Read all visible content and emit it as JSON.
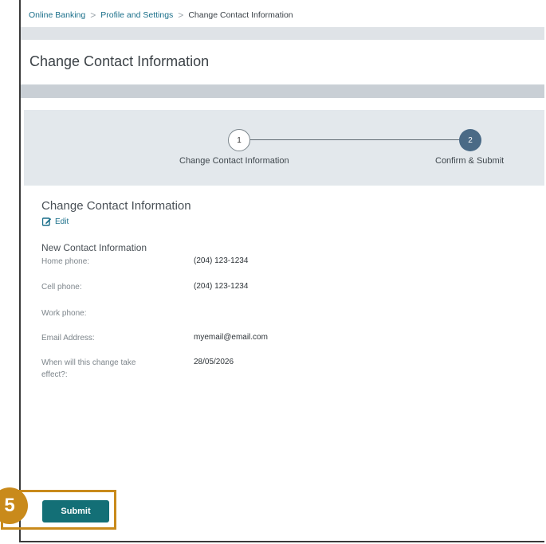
{
  "breadcrumb": {
    "items": [
      "Online Banking",
      "Profile and Settings",
      "Change Contact Information"
    ],
    "separator": ">"
  },
  "page": {
    "title": "Change Contact Information"
  },
  "stepper": {
    "steps": [
      {
        "number": "1",
        "label": "Change Contact Information"
      },
      {
        "number": "2",
        "label": "Confirm & Submit"
      }
    ],
    "active_step": 2
  },
  "summary": {
    "title": "Change Contact Information",
    "edit_label": "Edit",
    "subtitle": "New Contact Information",
    "fields": [
      {
        "label": "Home phone:",
        "value": "(204) 123-1234"
      },
      {
        "label": "Cell phone:",
        "value": "(204) 123-1234"
      },
      {
        "label": "Work phone:",
        "value": ""
      },
      {
        "label": "Email Address:",
        "value": "myemail@email.com"
      },
      {
        "label": "When will this change take effect?:",
        "value": "28/05/2026"
      }
    ]
  },
  "actions": {
    "submit_label": "Submit"
  },
  "annotation": {
    "step_number": "5",
    "color": "#c98a1b"
  },
  "colors": {
    "accent": "#136f76",
    "link": "#1a6f8a",
    "active_step": "#4a6a86"
  },
  "icons": {
    "edit": "edit-icon",
    "breadcrumb_separator": "chevron-right-icon"
  }
}
